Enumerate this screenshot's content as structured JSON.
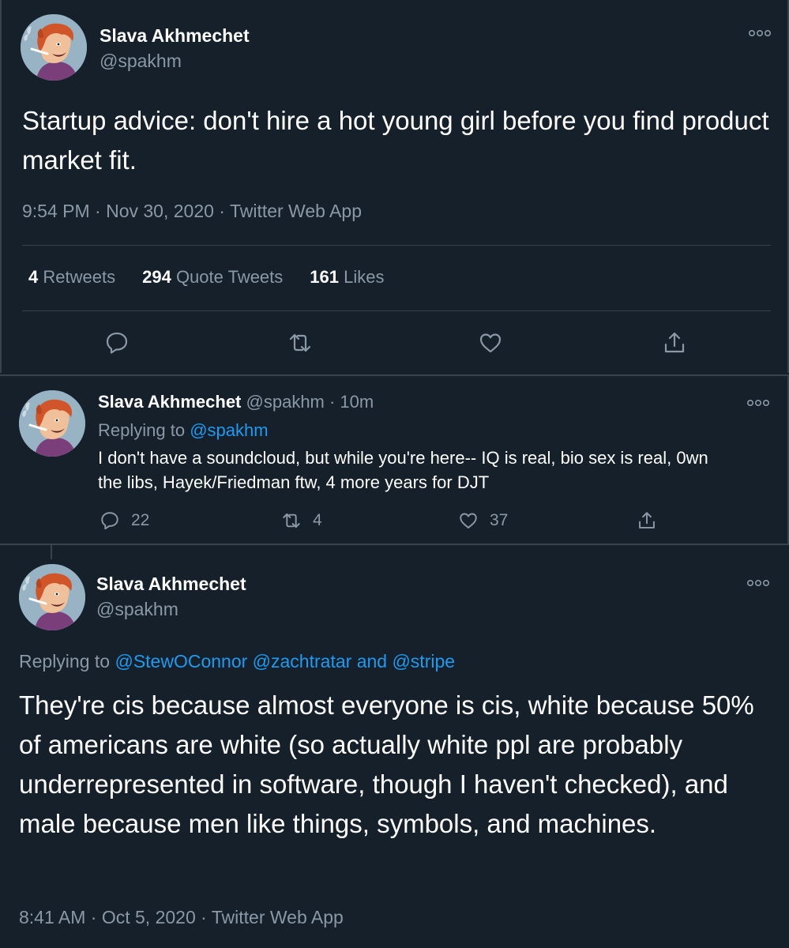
{
  "tweet": {
    "author_name": "Slava Akhmechet",
    "author_handle": "@spakhm",
    "text": "Startup advice: don't hire a hot young girl before you find product market fit.",
    "time": "9:54 PM · Nov 30, 2020 · Twitter Web App",
    "retweets_count": "4",
    "retweets_label": "Retweets",
    "quotes_count": "294",
    "quotes_label": "Quote Tweets",
    "likes_count": "161",
    "likes_label": "Likes",
    "icons": [
      "reply-icon",
      "retweet-icon",
      "like-icon",
      "share-icon"
    ]
  },
  "reply": {
    "author_name": "Slava Akhmechet",
    "author_handle": "@spakhm · 10m",
    "replying_label": "Replying to",
    "replying_to": "@spakhm",
    "text": "I don't have a soundcloud, but while you're here-- IQ is real, bio sex is real, 0wn the libs, Hayek/Friedman ftw, 4 more years for DJT",
    "reply_count": "22",
    "retweet_count": "4",
    "like_count": "37"
  },
  "tweet3": {
    "author_name": "Slava Akhmechet",
    "author_handle": "@spakhm",
    "replying_label": "Replying to",
    "mention1": "@StewOConnor",
    "mention2": "@zachtratar",
    "and_label": "and",
    "mention3": "@stripe",
    "text": "They're cis because almost everyone is cis, white because 50% of americans are white (so actually white ppl are probably underrepresented in software, though I haven't checked), and male because men like things, symbols, and machines.",
    "time": "8:41 AM · Oct 5, 2020 · Twitter Web App"
  },
  "colors": {
    "background": "#15202b",
    "text_primary": "#ffffff",
    "text_secondary": "#8b98a5",
    "link": "#1d9bf0",
    "border": "#38444d"
  }
}
